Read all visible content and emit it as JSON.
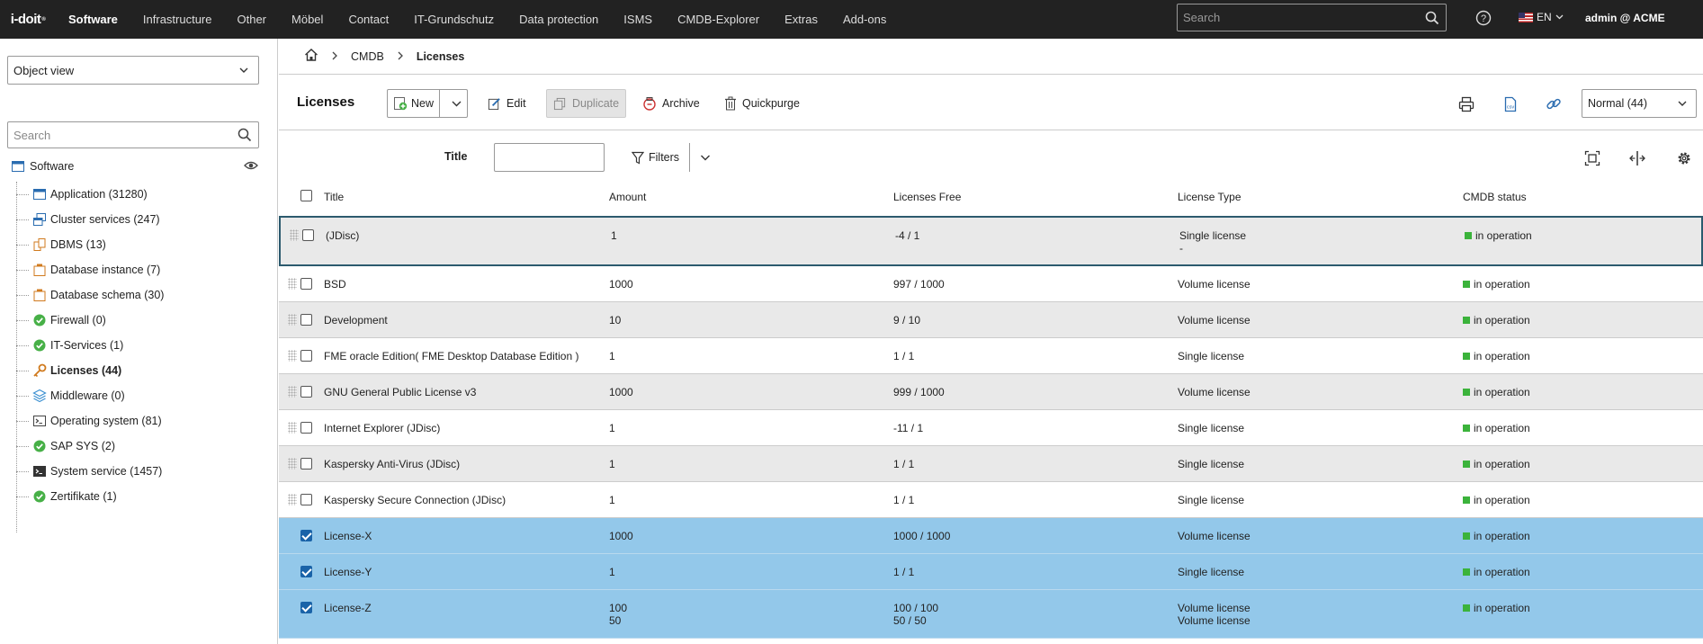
{
  "app": {
    "logo": "i-doit"
  },
  "nav": [
    "Software",
    "Infrastructure",
    "Other",
    "Möbel",
    "Contact",
    "IT-Grundschutz",
    "Data protection",
    "ISMS",
    "CMDB-Explorer",
    "Extras",
    "Add-ons"
  ],
  "top_search": {
    "placeholder": "Search"
  },
  "lang": "EN",
  "user": "admin @ ACME",
  "sidebar": {
    "object_view": "Object view",
    "search_placeholder": "Search",
    "root": "Software",
    "items": [
      {
        "label": "Application (31280)",
        "icon": "window-icon"
      },
      {
        "label": "Cluster services (247)",
        "icon": "cluster-icon"
      },
      {
        "label": "DBMS (13)",
        "icon": "dbms-icon"
      },
      {
        "label": "Database instance (7)",
        "icon": "database-instance-icon"
      },
      {
        "label": "Database schema (30)",
        "icon": "database-schema-icon"
      },
      {
        "label": "Firewall (0)",
        "icon": "check-circle-icon"
      },
      {
        "label": "IT-Services (1)",
        "icon": "check-circle-icon"
      },
      {
        "label": "Licenses (44)",
        "icon": "key-icon",
        "selected": true
      },
      {
        "label": "Middleware (0)",
        "icon": "layers-icon"
      },
      {
        "label": "Operating system (81)",
        "icon": "terminal-icon"
      },
      {
        "label": "SAP SYS (2)",
        "icon": "check-circle-icon"
      },
      {
        "label": "System service (1457)",
        "icon": "terminal-icon"
      },
      {
        "label": "Zertifikate (1)",
        "icon": "check-circle-icon"
      }
    ]
  },
  "breadcrumb": {
    "level1": "CMDB",
    "current": "Licenses"
  },
  "toolbar": {
    "title": "Licenses",
    "new": "New",
    "edit": "Edit",
    "duplicate": "Duplicate",
    "archive": "Archive",
    "quickpurge": "Quickpurge",
    "view_select": "Normal (44)"
  },
  "filter": {
    "title_label": "Title",
    "filters_label": "Filters"
  },
  "table": {
    "columns": [
      "Title",
      "Amount",
      "Licenses Free",
      "License Type",
      "CMDB status"
    ],
    "rows": [
      {
        "title": "(JDisc)",
        "amount": "1",
        "amount2": "",
        "free": "-4 / 1",
        "free2": "",
        "type": "Single license",
        "type2": "-",
        "status": "in operation",
        "checked": false
      },
      {
        "title": "BSD",
        "amount": "1000",
        "amount2": "",
        "free": "997 / 1000",
        "free2": "",
        "type": "Volume license",
        "type2": "",
        "status": "in operation",
        "checked": false
      },
      {
        "title": "Development",
        "amount": "10",
        "amount2": "",
        "free": "9 / 10",
        "free2": "",
        "type": "Volume license",
        "type2": "",
        "status": "in operation",
        "checked": false
      },
      {
        "title": "FME oracle Edition( FME Desktop Database Edition )",
        "amount": "1",
        "amount2": "",
        "free": "1 / 1",
        "free2": "",
        "type": "Single license",
        "type2": "",
        "status": "in operation",
        "checked": false
      },
      {
        "title": "GNU General Public License v3",
        "amount": "1000",
        "amount2": "",
        "free": "999 / 1000",
        "free2": "",
        "type": "Volume license",
        "type2": "",
        "status": "in operation",
        "checked": false
      },
      {
        "title": "Internet Explorer (JDisc)",
        "amount": "1",
        "amount2": "",
        "free": "-11 / 1",
        "free2": "",
        "type": "Single license",
        "type2": "",
        "status": "in operation",
        "checked": false
      },
      {
        "title": "Kaspersky Anti-Virus (JDisc)",
        "amount": "1",
        "amount2": "",
        "free": "1 / 1",
        "free2": "",
        "type": "Single license",
        "type2": "",
        "status": "in operation",
        "checked": false
      },
      {
        "title": "Kaspersky Secure Connection (JDisc)",
        "amount": "1",
        "amount2": "",
        "free": "1 / 1",
        "free2": "",
        "type": "Single license",
        "type2": "",
        "status": "in operation",
        "checked": false
      },
      {
        "title": "License-X",
        "amount": "1000",
        "amount2": "",
        "free": "1000 / 1000",
        "free2": "",
        "type": "Volume license",
        "type2": "",
        "status": "in operation",
        "checked": true
      },
      {
        "title": "License-Y",
        "amount": "1",
        "amount2": "",
        "free": "1 / 1",
        "free2": "",
        "type": "Single license",
        "type2": "",
        "status": "in operation",
        "checked": true
      },
      {
        "title": "License-Z",
        "amount": "100",
        "amount2": "50",
        "free": "100 / 100",
        "free2": "50 / 50",
        "type": "Volume license",
        "type2": "Volume license",
        "status": "in operation",
        "checked": true
      }
    ]
  },
  "colors": {
    "topbar": "#222222",
    "selected_row": "#93c8ea",
    "status_green": "#3bb33b",
    "alt_row": "#e9e9e9"
  }
}
